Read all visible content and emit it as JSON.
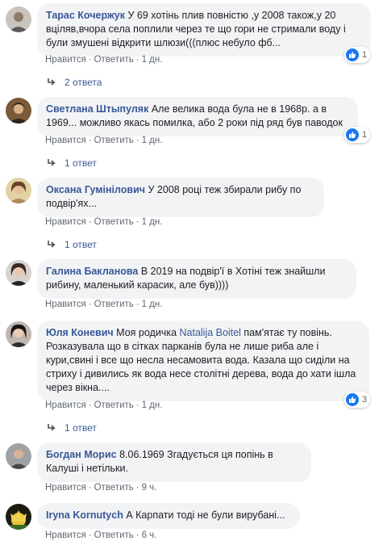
{
  "like_label": "Нравится",
  "reply_label": "Ответить",
  "separator": "·",
  "comments": [
    {
      "author": "Тарас Кочержук",
      "text": " У 69 хотінь плив повністю ,у 2008 також,у 20 вціляв,вчора села поплили через те що гори не стримали воду і були змушені відкрити шлюзи(((плюс небуло фб...",
      "time": "1 дн.",
      "reactions": "1",
      "replies_label": "2 ответа"
    },
    {
      "author": "Светлана Штыпуляк",
      "text": " Але велика вода була не в 1968р. а в 1969... можливо якась помилка, або 2 роки під ряд був паводок",
      "time": "1 дн.",
      "reactions": "1",
      "replies_label": "1 ответ"
    },
    {
      "author": "Оксана Гумінілович",
      "text": " У 2008 році теж збирали рибу по подвір'ях...",
      "time": "1 дн.",
      "replies_label": "1 ответ"
    },
    {
      "author": "Галина Бакланова",
      "text": " В 2019 на подвір'ї в Хотіні теж знайшли рибину, маленький карасик, але був))))",
      "time": "1 дн."
    },
    {
      "author": "Юля Коневич",
      "text_before": " Моя родичка ",
      "mention": "Natalija Boitel",
      "text_after": " пам'ятає ту повінь. Розказувала що в сітках парканів була не лише риба але і кури,свині і все що несла несамовита вода. Казала що сиділи на стриху і дивились як вода несе столітні дерева, вода до хати ішла через вікна....",
      "time": "1 дн.",
      "reactions": "3",
      "replies_label": "1 ответ"
    },
    {
      "author": "Богдан Морис",
      "text": " 8.06.1969 Згадується ця попінь в Калуші і нетільки.",
      "time": "9 ч."
    },
    {
      "author": "Iryna Kornutych",
      "text": " А Карпати тоді не були вирубані...",
      "time": "6 ч."
    }
  ],
  "colors": {
    "link": "#385898",
    "bubble": "#f2f3f5",
    "meta": "#606770",
    "like_badge": "#1877f2"
  }
}
